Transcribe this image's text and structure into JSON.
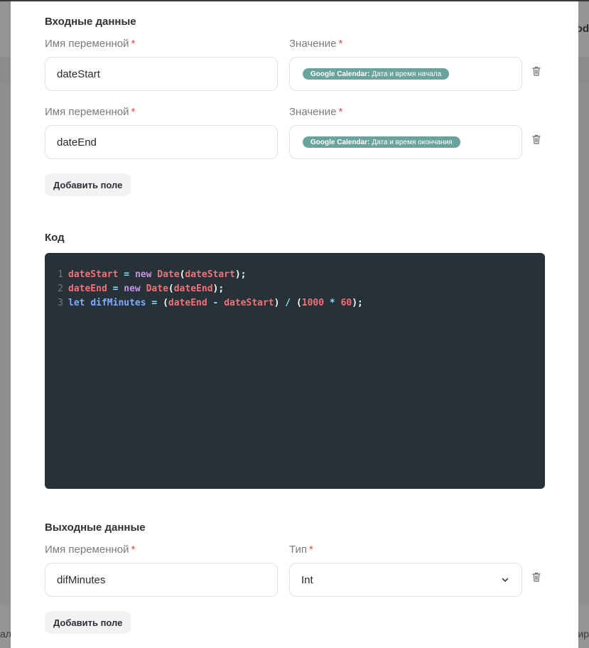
{
  "background": {
    "right_fragment": "od",
    "left_bottom_fragment": "ал",
    "right_bottom_fragment": "ир"
  },
  "input_section": {
    "title": "Входные данные",
    "rows": [
      {
        "name_label": "Имя переменной",
        "name_value": "dateStart",
        "value_label": "Значение",
        "chip_source": "Google Calendar:",
        "chip_text": "Дата и время начала"
      },
      {
        "name_label": "Имя переменной",
        "name_value": "dateEnd",
        "value_label": "Значение",
        "chip_source": "Google Calendar:",
        "chip_text": "Дата и время окончания"
      }
    ],
    "add_button": "Добавить поле"
  },
  "code_section": {
    "title": "Код",
    "line_numbers": [
      "1",
      "2",
      "3"
    ]
  },
  "output_section": {
    "title": "Выходные данные",
    "name_label": "Имя переменной",
    "name_value": "difMinutes",
    "type_label": "Тип",
    "type_value": "Int",
    "add_button": "Добавить поле"
  },
  "required_mark": "*",
  "colors": {
    "chip": "#6aa39e",
    "required": "#e14b4b",
    "code_bg": "#263238"
  },
  "icons": [
    "trash-icon",
    "chevron-down-icon"
  ]
}
